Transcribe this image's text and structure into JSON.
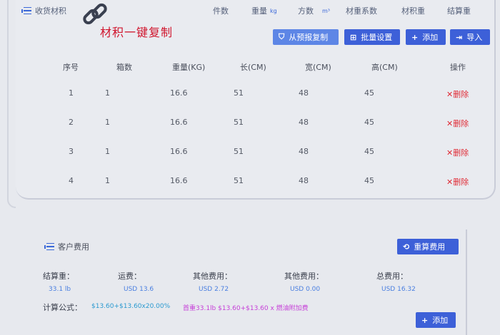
{
  "card": {
    "title": "收货材积"
  },
  "header_fields": [
    {
      "label": "件数",
      "unit": ""
    },
    {
      "label": "重量",
      "unit": "kg"
    },
    {
      "label": "方数",
      "unit": "m³"
    },
    {
      "label": "材重系数",
      "unit": ""
    },
    {
      "label": "材积重",
      "unit": ""
    },
    {
      "label": "结算重",
      "unit": ""
    }
  ],
  "promo_text": "材积一键复制",
  "toolbar": {
    "copy_label": "从预报复制",
    "batch_label": "批量设置",
    "add_label": "添加",
    "import_label": "导入"
  },
  "table": {
    "columns": [
      "序号",
      "箱数",
      "重量(KG)",
      "长(CM)",
      "宽(CM)",
      "高(CM)",
      "操作"
    ],
    "rows": [
      [
        "1",
        "1",
        "16.6",
        "51",
        "48",
        "45",
        "删除"
      ],
      [
        "2",
        "1",
        "16.6",
        "51",
        "48",
        "45",
        "删除"
      ],
      [
        "3",
        "1",
        "16.6",
        "51",
        "48",
        "45",
        "删除"
      ],
      [
        "4",
        "1",
        "16.6",
        "51",
        "48",
        "45",
        "删除"
      ]
    ]
  },
  "fees": {
    "title": "客户费用",
    "recalc_label": "重算费用",
    "add_label": "添加",
    "summary": [
      {
        "label": "结算重：",
        "value": "33.1 lb"
      },
      {
        "label": "运费：",
        "value": "USD 13.6"
      },
      {
        "label": "其他费用：",
        "value": "USD 2.72"
      },
      {
        "label": "其他费用：",
        "value": "USD 0.00"
      },
      {
        "label": "总费用：",
        "value": "USD 16.32"
      }
    ],
    "formula_label": "计算公式：",
    "formula_main": "$13.60+$13.60x20.00%",
    "formula_detail": "首重33.1lb $13.60+$13.60 x 燃油附加费"
  },
  "colors": {
    "accent": "#3d60d8",
    "accent_light": "#5d86e6",
    "danger": "#e02b36",
    "promo": "#d0142c"
  }
}
